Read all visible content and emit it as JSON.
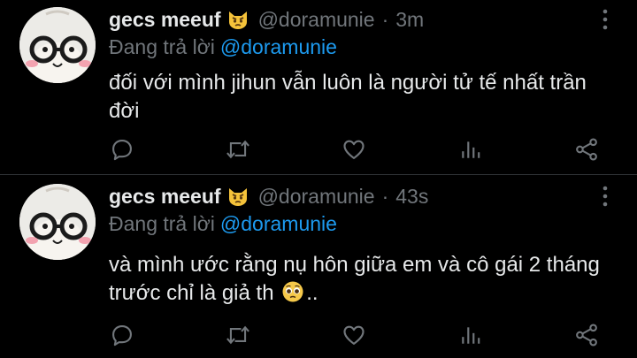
{
  "tweets": [
    {
      "display_name": "gecs meeuf",
      "handle": "@doramunie",
      "separator": "·",
      "time": "3m",
      "reply_prefix": "Đang trả lời",
      "reply_mention": "@doramunie",
      "text_main": "đối với mình jihun vẫn luôn là người tử tế nhất trần đời",
      "text_tail": ""
    },
    {
      "display_name": "gecs meeuf",
      "handle": "@doramunie",
      "separator": "·",
      "time": "43s",
      "reply_prefix": "Đang trả lời",
      "reply_mention": "@doramunie",
      "text_main": "và mình ước rằng nụ hôn giữa em và cô gái 2 tháng trước chỉ là giả th",
      "text_tail": ".."
    }
  ],
  "icons": {
    "name_emoji": "pouting-cat-emoji-icon",
    "pleading_emoji": "pleading-face-emoji-icon",
    "more": "more-vertical-icon",
    "reply": "reply-bubble-icon",
    "retweet": "retweet-icon",
    "like": "heart-icon",
    "stats": "analytics-bars-icon",
    "share": "share-icon"
  },
  "colors": {
    "background": "#000000",
    "text_primary": "#e7e9ea",
    "text_secondary": "#71767b",
    "accent": "#1d9bf0",
    "divider": "#2f3336"
  }
}
